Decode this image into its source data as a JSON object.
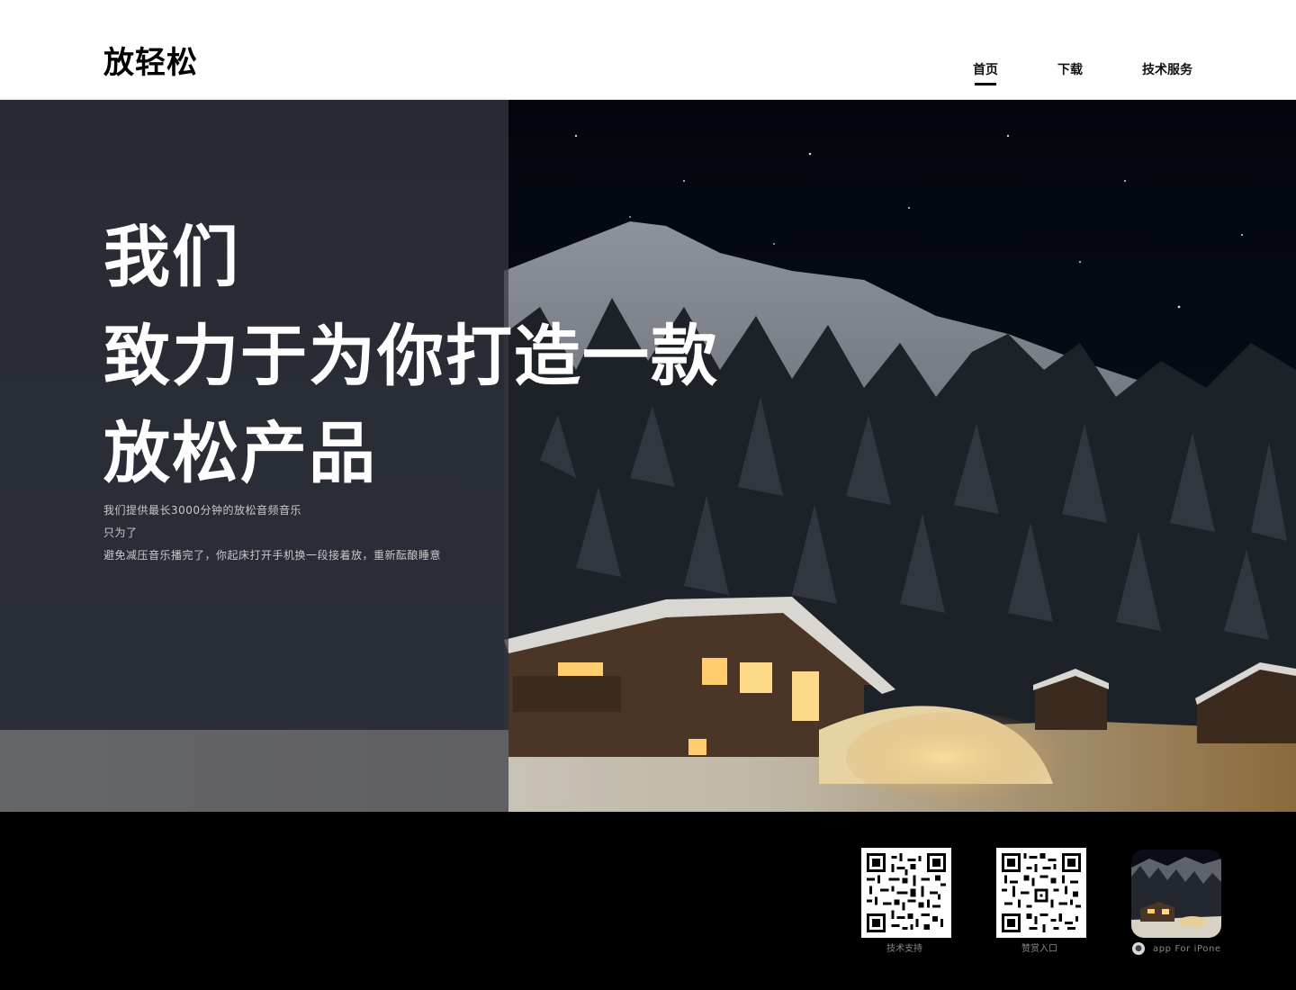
{
  "header": {
    "logo": "放轻松",
    "nav": [
      {
        "label": "首页",
        "active": true
      },
      {
        "label": "下载",
        "active": false
      },
      {
        "label": "技术服务",
        "active": false
      }
    ]
  },
  "hero": {
    "headline": [
      "我们",
      "致力于为你打造一款",
      "放松产品"
    ],
    "subtitle": [
      "我们提供最长3000分钟的放松音频音乐",
      "只为了",
      "避免减压音乐播完了，你起床打开手机换一段接着放，重新酝酿睡意"
    ],
    "image_icon": "snowy-cabin-night-image"
  },
  "footer": {
    "qr_support": {
      "caption": "技术支持",
      "icon": "qr-code-icon"
    },
    "qr_donate": {
      "caption": "赞赏入口",
      "icon": "qr-code-icon"
    },
    "app": {
      "caption": "app For iPone",
      "icon": "apple-icon"
    }
  },
  "colors": {
    "header_bg": "#ffffff",
    "nav_underline": "#000000",
    "footer_bg": "#000000",
    "overlay": "#373a42"
  }
}
